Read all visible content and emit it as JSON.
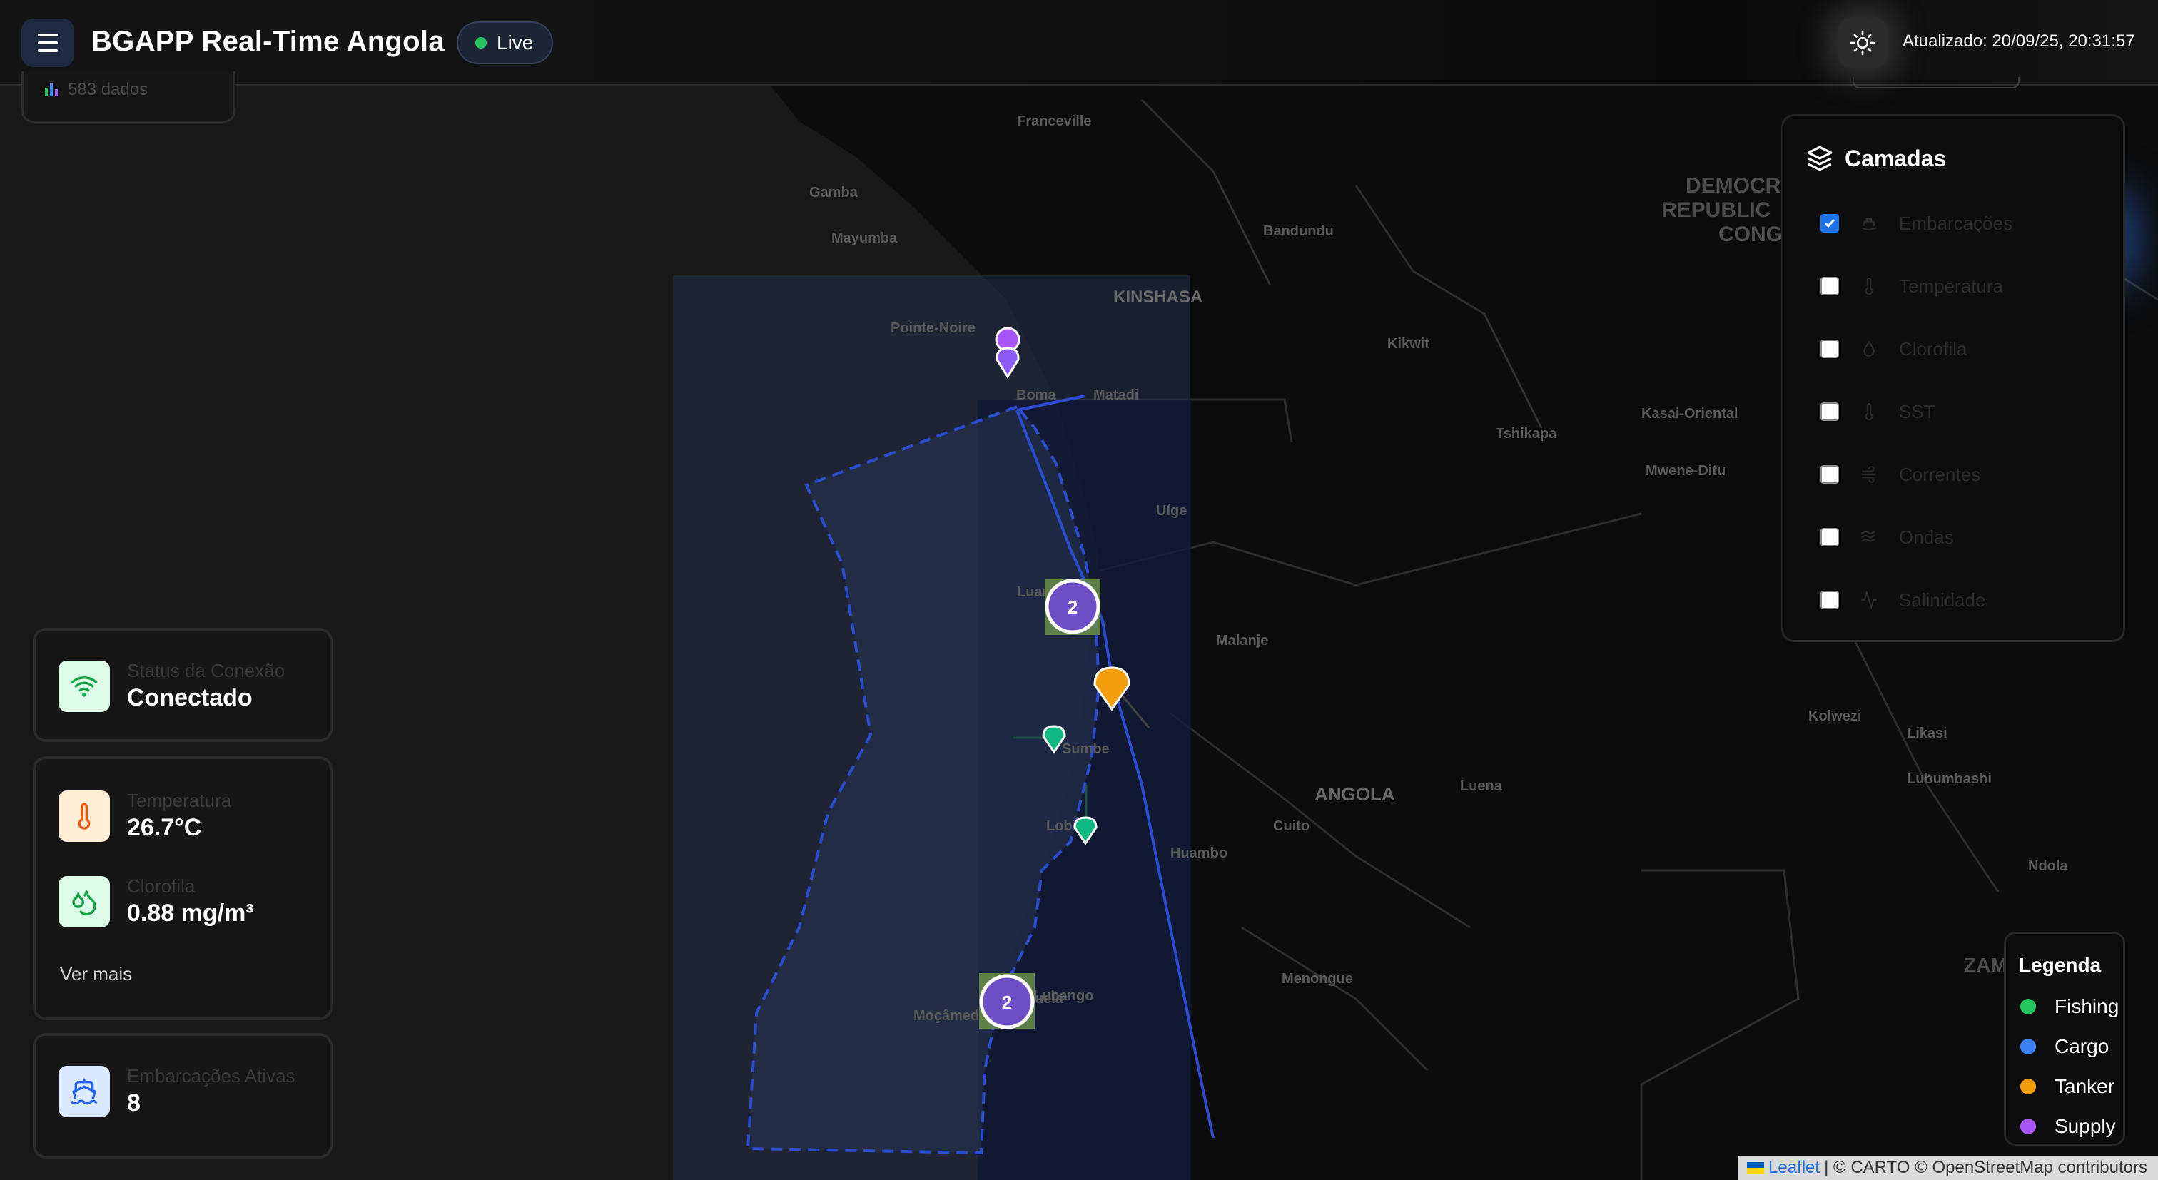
{
  "header": {
    "app_title": "BGAPP Real-Time Angola",
    "live_label": "Live",
    "updated_text": "Atualizado: 20/09/25, 20:31:57"
  },
  "top_card": {
    "label": "583 dados"
  },
  "status": {
    "connection": {
      "label": "Status da Conexão",
      "value": "Conectado"
    },
    "temperature": {
      "label": "Temperatura",
      "value": "26.7°C"
    },
    "chlorophyll": {
      "label": "Clorofila",
      "value": "0.88 mg/m³"
    },
    "more_link": "Ver mais",
    "vessels": {
      "label": "Embarcações Ativas",
      "value": "8"
    }
  },
  "layers": {
    "title": "Camadas",
    "items": [
      {
        "label": "Embarcações",
        "icon": "ship-icon",
        "checked": true
      },
      {
        "label": "Temperatura",
        "icon": "thermometer-icon",
        "checked": false
      },
      {
        "label": "Clorofila",
        "icon": "droplets-icon",
        "checked": false
      },
      {
        "label": "SST",
        "icon": "thermometer-icon",
        "checked": false
      },
      {
        "label": "Correntes",
        "icon": "wind-icon",
        "checked": false
      },
      {
        "label": "Ondas",
        "icon": "waves-icon",
        "checked": false
      },
      {
        "label": "Salinidade",
        "icon": "activity-icon",
        "checked": false
      }
    ]
  },
  "legend": {
    "title": "Legenda",
    "items": [
      {
        "label": "Fishing",
        "color": "#22c55e"
      },
      {
        "label": "Cargo",
        "color": "#3b82f6"
      },
      {
        "label": "Tanker",
        "color": "#f59e0b"
      },
      {
        "label": "Supply",
        "color": "#a855f7"
      }
    ]
  },
  "map": {
    "place_labels": [
      "Franceville",
      "Gamba",
      "Mayumba",
      "Pointe-Noire",
      "Boma",
      "Matadi",
      "KINSHASA",
      "Bandundu",
      "Kikwit",
      "Tshikapa",
      "Kasai-Oriental",
      "Mwene-Ditu",
      "DEMOCRATIC",
      "REPUBLIC",
      "CONGO",
      "Uíge",
      "Luanda",
      "Malanje",
      "Sumbe",
      "Lobito",
      "Benguela",
      "Huambo",
      "Cuito",
      "Luena",
      "Menongue",
      "Moçâmedes",
      "Lubango",
      "ANGOLA",
      "Kolwezi",
      "Likasi",
      "Lubumbashi",
      "Ndola",
      "ZAMBIA"
    ],
    "clusters": [
      {
        "count": "2"
      },
      {
        "count": "2"
      }
    ]
  },
  "attribution": {
    "leaflet": "Leaflet",
    "text": "| © CARTO © OpenStreetMap contributors"
  }
}
